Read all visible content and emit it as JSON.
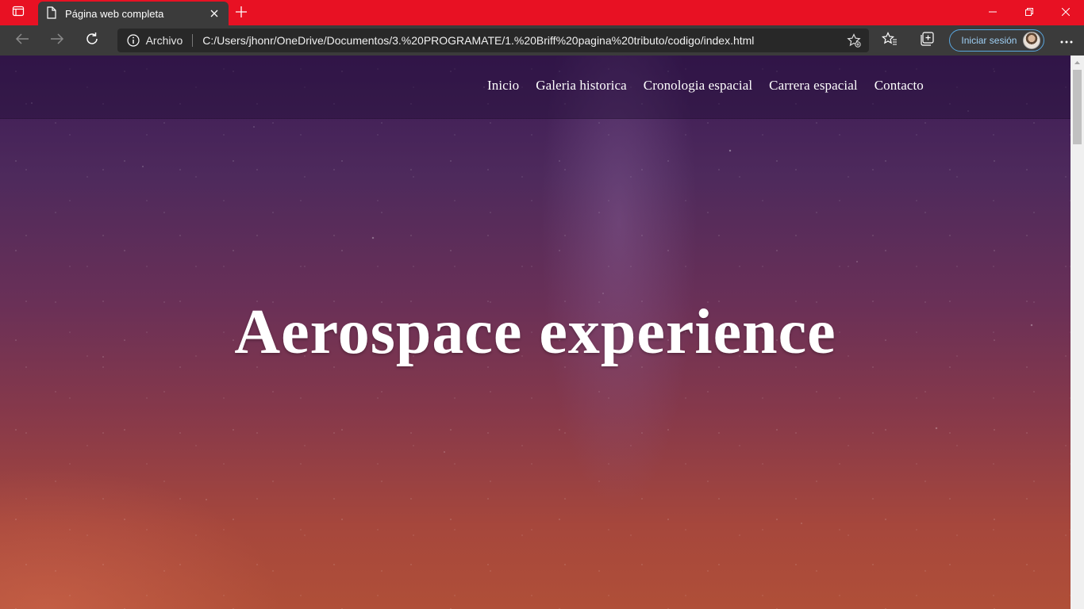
{
  "browser": {
    "tab": {
      "title": "Página web completa"
    },
    "address": {
      "site_label": "Archivo",
      "url": "C:/Users/jhonr/OneDrive/Documentos/3.%20PROGRAMATE/1.%20Briff%20pagina%20tributo/codigo/index.html"
    },
    "profile": {
      "signin_label": "Iniciar sesión"
    },
    "colors": {
      "titlebar": "#e81123",
      "toolbar": "#3b3b3b",
      "omnibox": "#282828"
    }
  },
  "page": {
    "nav": [
      {
        "label": "Inicio"
      },
      {
        "label": "Galeria historica"
      },
      {
        "label": "Cronologia espacial"
      },
      {
        "label": "Carrera espacial"
      },
      {
        "label": "Contacto"
      }
    ],
    "hero": {
      "title": "Aerospace experience"
    }
  }
}
